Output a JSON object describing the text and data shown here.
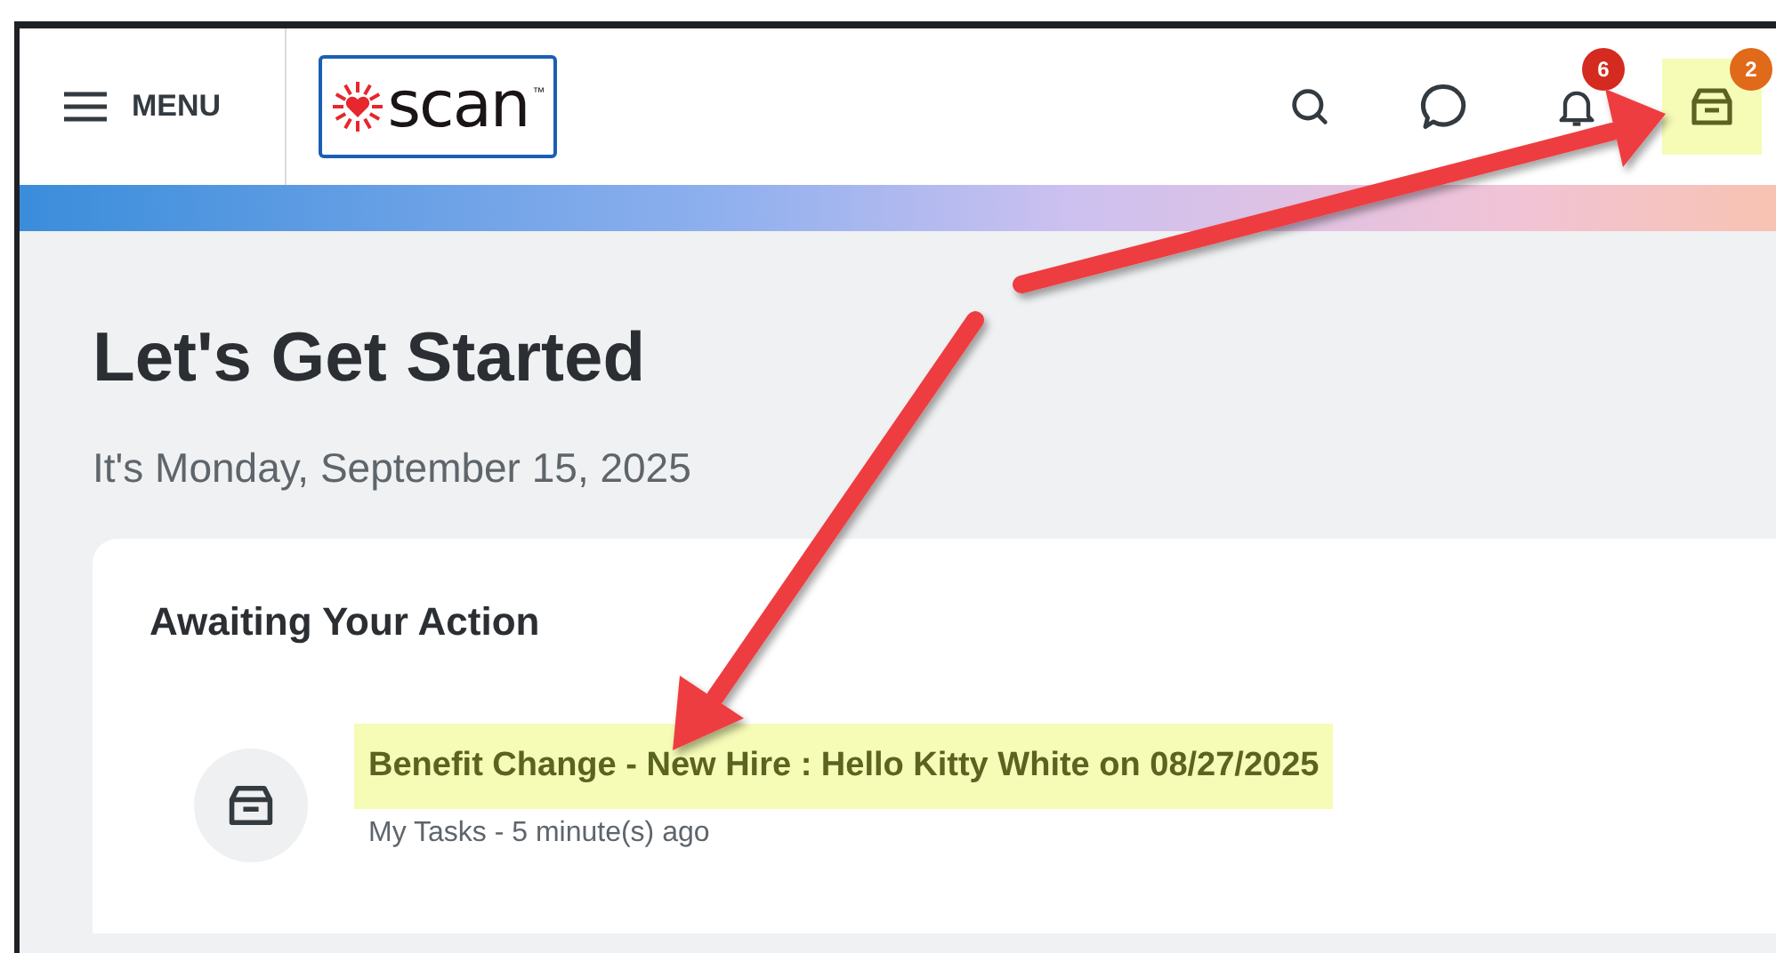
{
  "header": {
    "menu_label": "MENU",
    "logo": {
      "text": "scan",
      "trademark": "™"
    },
    "actions": [
      {
        "kind": "search",
        "highlighted": false
      },
      {
        "kind": "chat",
        "highlighted": false
      },
      {
        "kind": "bell",
        "badge": "6",
        "color": "#d42a20",
        "highlighted": false
      },
      {
        "kind": "inbox",
        "badge": "2",
        "color": "#e0691a",
        "highlighted": true
      }
    ]
  },
  "page": {
    "title": "Let's Get Started",
    "date": "It's Monday, September 15, 2025"
  },
  "card": {
    "title": "Awaiting Your Action",
    "items": [
      {
        "title": "Benefit Change - New Hire : Hello Kitty White on 08/27/2025",
        "subtitle": "My Tasks - 5 minute(s) ago",
        "highlighted": true
      }
    ]
  }
}
